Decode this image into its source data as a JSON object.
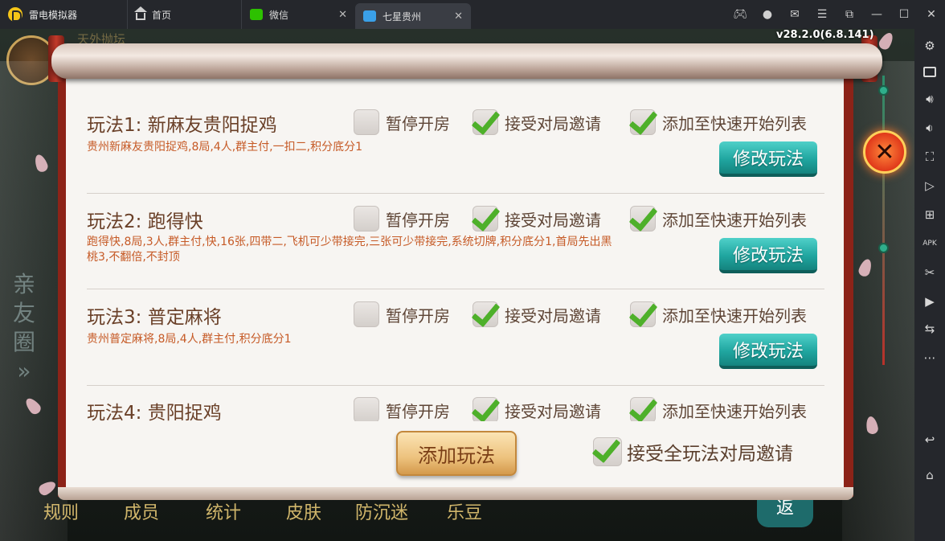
{
  "titlebar": {
    "app_name": "雷电模拟器",
    "tabs": [
      {
        "label": "首页",
        "icon": "home-icon"
      },
      {
        "label": "微信",
        "icon": "wechat-icon"
      },
      {
        "label": "七星贵州",
        "icon": "game-icon",
        "active": true
      }
    ],
    "close_tab": "✕",
    "window_controls": [
      "gamepad-icon",
      "user-icon",
      "mail-icon",
      "menu-icon",
      "restore-icon",
      "minimize-icon",
      "maximize-icon",
      "close-icon"
    ]
  },
  "sidebar": {
    "tools": [
      "settings-icon",
      "keyboard-icon",
      "volume-up-icon",
      "volume-down-icon",
      "fullscreen-icon",
      "play-icon",
      "add-screen-icon",
      "apk-icon",
      "scissors-icon",
      "video-icon",
      "sync-icon",
      "more-icon",
      "back-icon",
      "home-icon"
    ]
  },
  "game": {
    "version": "v28.2.0(6.8.141)",
    "background": {
      "top_text": "天外抛坛",
      "left_side_text": [
        "亲",
        "友",
        "圈",
        "»"
      ],
      "nav_items": [
        "规则",
        "成员",
        "统计",
        "皮肤",
        "防沉迷",
        "乐豆"
      ],
      "corner_button": "返"
    },
    "rows": [
      {
        "title": "玩法1:  新麻友贵阳捉鸡",
        "desc": "贵州新麻友贵阳捉鸡,8局,4人,群主付,一扣二,积分底分1",
        "pause_label": "暂停开房",
        "pause_checked": false,
        "accept_label": "接受对局邀请",
        "accept_checked": true,
        "quick_label": "添加至快速开始列表",
        "quick_checked": true,
        "modify_label": "修改玩法"
      },
      {
        "title": "玩法2:  跑得快",
        "desc": "跑得快,8局,3人,群主付,快,16张,四带二,飞机可少带接完,三张可少带接完,系统切牌,积分底分1,首局先出黑桃3,不翻倍,不封顶",
        "pause_label": "暂停开房",
        "pause_checked": false,
        "accept_label": "接受对局邀请",
        "accept_checked": true,
        "quick_label": "添加至快速开始列表",
        "quick_checked": true,
        "modify_label": "修改玩法"
      },
      {
        "title": "玩法3:  普定麻将",
        "desc": "贵州普定麻将,8局,4人,群主付,积分底分1",
        "pause_label": "暂停开房",
        "pause_checked": false,
        "accept_label": "接受对局邀请",
        "accept_checked": true,
        "quick_label": "添加至快速开始列表",
        "quick_checked": true,
        "modify_label": "修改玩法"
      },
      {
        "title": "玩法4:  贵阳捉鸡",
        "desc": "",
        "pause_label": "暂停开房",
        "pause_checked": false,
        "accept_label": "接受对局邀请",
        "accept_checked": true,
        "quick_label": "添加至快速开始列表",
        "quick_checked": true,
        "modify_label": ""
      }
    ],
    "add_button": "添加玩法",
    "accept_all_label": "接受全玩法对局邀请",
    "accept_all_checked": true,
    "close_symbol": "✕"
  }
}
